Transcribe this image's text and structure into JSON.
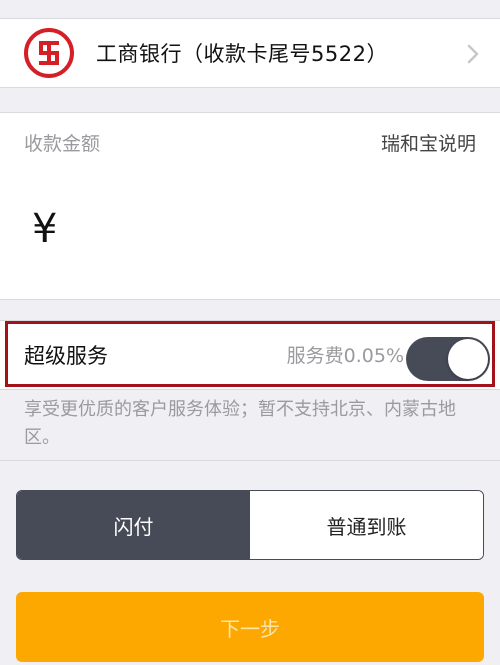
{
  "bank": {
    "name": "工商银行（收款卡尾号5522）",
    "logo_color": "#d41f26"
  },
  "amount": {
    "label": "收款金额",
    "help_link": "瑞和宝说明",
    "currency_symbol": "¥"
  },
  "service": {
    "label": "超级服务",
    "fee": "服务费0.05%",
    "enabled": true,
    "note": "享受更优质的客户服务体验；暂不支持北京、内蒙古地区。"
  },
  "payment_mode": {
    "options": [
      "闪付",
      "普通到账"
    ],
    "selected": "闪付"
  },
  "next_button": {
    "label": "下一步",
    "color": "#fda800"
  },
  "colors": {
    "accent_dark": "#474a57",
    "highlight_border": "#a3121a",
    "background": "#efeff4"
  }
}
